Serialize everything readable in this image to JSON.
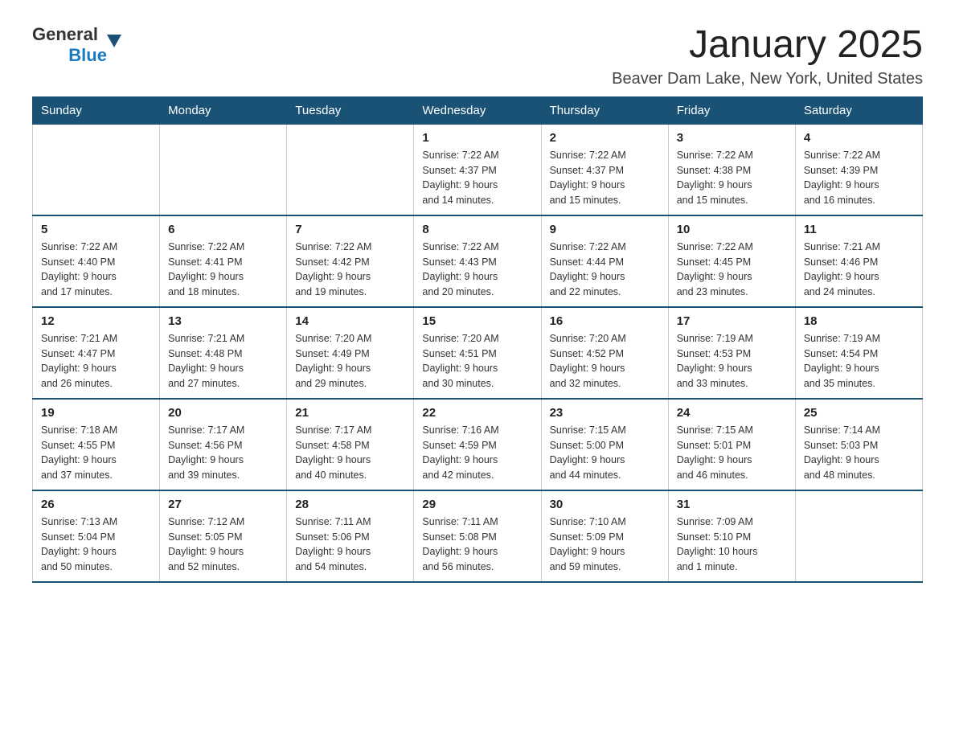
{
  "logo": {
    "general": "General",
    "blue": "Blue"
  },
  "title": "January 2025",
  "location": "Beaver Dam Lake, New York, United States",
  "days_of_week": [
    "Sunday",
    "Monday",
    "Tuesday",
    "Wednesday",
    "Thursday",
    "Friday",
    "Saturday"
  ],
  "weeks": [
    [
      {
        "day": "",
        "info": ""
      },
      {
        "day": "",
        "info": ""
      },
      {
        "day": "",
        "info": ""
      },
      {
        "day": "1",
        "info": "Sunrise: 7:22 AM\nSunset: 4:37 PM\nDaylight: 9 hours\nand 14 minutes."
      },
      {
        "day": "2",
        "info": "Sunrise: 7:22 AM\nSunset: 4:37 PM\nDaylight: 9 hours\nand 15 minutes."
      },
      {
        "day": "3",
        "info": "Sunrise: 7:22 AM\nSunset: 4:38 PM\nDaylight: 9 hours\nand 15 minutes."
      },
      {
        "day": "4",
        "info": "Sunrise: 7:22 AM\nSunset: 4:39 PM\nDaylight: 9 hours\nand 16 minutes."
      }
    ],
    [
      {
        "day": "5",
        "info": "Sunrise: 7:22 AM\nSunset: 4:40 PM\nDaylight: 9 hours\nand 17 minutes."
      },
      {
        "day": "6",
        "info": "Sunrise: 7:22 AM\nSunset: 4:41 PM\nDaylight: 9 hours\nand 18 minutes."
      },
      {
        "day": "7",
        "info": "Sunrise: 7:22 AM\nSunset: 4:42 PM\nDaylight: 9 hours\nand 19 minutes."
      },
      {
        "day": "8",
        "info": "Sunrise: 7:22 AM\nSunset: 4:43 PM\nDaylight: 9 hours\nand 20 minutes."
      },
      {
        "day": "9",
        "info": "Sunrise: 7:22 AM\nSunset: 4:44 PM\nDaylight: 9 hours\nand 22 minutes."
      },
      {
        "day": "10",
        "info": "Sunrise: 7:22 AM\nSunset: 4:45 PM\nDaylight: 9 hours\nand 23 minutes."
      },
      {
        "day": "11",
        "info": "Sunrise: 7:21 AM\nSunset: 4:46 PM\nDaylight: 9 hours\nand 24 minutes."
      }
    ],
    [
      {
        "day": "12",
        "info": "Sunrise: 7:21 AM\nSunset: 4:47 PM\nDaylight: 9 hours\nand 26 minutes."
      },
      {
        "day": "13",
        "info": "Sunrise: 7:21 AM\nSunset: 4:48 PM\nDaylight: 9 hours\nand 27 minutes."
      },
      {
        "day": "14",
        "info": "Sunrise: 7:20 AM\nSunset: 4:49 PM\nDaylight: 9 hours\nand 29 minutes."
      },
      {
        "day": "15",
        "info": "Sunrise: 7:20 AM\nSunset: 4:51 PM\nDaylight: 9 hours\nand 30 minutes."
      },
      {
        "day": "16",
        "info": "Sunrise: 7:20 AM\nSunset: 4:52 PM\nDaylight: 9 hours\nand 32 minutes."
      },
      {
        "day": "17",
        "info": "Sunrise: 7:19 AM\nSunset: 4:53 PM\nDaylight: 9 hours\nand 33 minutes."
      },
      {
        "day": "18",
        "info": "Sunrise: 7:19 AM\nSunset: 4:54 PM\nDaylight: 9 hours\nand 35 minutes."
      }
    ],
    [
      {
        "day": "19",
        "info": "Sunrise: 7:18 AM\nSunset: 4:55 PM\nDaylight: 9 hours\nand 37 minutes."
      },
      {
        "day": "20",
        "info": "Sunrise: 7:17 AM\nSunset: 4:56 PM\nDaylight: 9 hours\nand 39 minutes."
      },
      {
        "day": "21",
        "info": "Sunrise: 7:17 AM\nSunset: 4:58 PM\nDaylight: 9 hours\nand 40 minutes."
      },
      {
        "day": "22",
        "info": "Sunrise: 7:16 AM\nSunset: 4:59 PM\nDaylight: 9 hours\nand 42 minutes."
      },
      {
        "day": "23",
        "info": "Sunrise: 7:15 AM\nSunset: 5:00 PM\nDaylight: 9 hours\nand 44 minutes."
      },
      {
        "day": "24",
        "info": "Sunrise: 7:15 AM\nSunset: 5:01 PM\nDaylight: 9 hours\nand 46 minutes."
      },
      {
        "day": "25",
        "info": "Sunrise: 7:14 AM\nSunset: 5:03 PM\nDaylight: 9 hours\nand 48 minutes."
      }
    ],
    [
      {
        "day": "26",
        "info": "Sunrise: 7:13 AM\nSunset: 5:04 PM\nDaylight: 9 hours\nand 50 minutes."
      },
      {
        "day": "27",
        "info": "Sunrise: 7:12 AM\nSunset: 5:05 PM\nDaylight: 9 hours\nand 52 minutes."
      },
      {
        "day": "28",
        "info": "Sunrise: 7:11 AM\nSunset: 5:06 PM\nDaylight: 9 hours\nand 54 minutes."
      },
      {
        "day": "29",
        "info": "Sunrise: 7:11 AM\nSunset: 5:08 PM\nDaylight: 9 hours\nand 56 minutes."
      },
      {
        "day": "30",
        "info": "Sunrise: 7:10 AM\nSunset: 5:09 PM\nDaylight: 9 hours\nand 59 minutes."
      },
      {
        "day": "31",
        "info": "Sunrise: 7:09 AM\nSunset: 5:10 PM\nDaylight: 10 hours\nand 1 minute."
      },
      {
        "day": "",
        "info": ""
      }
    ]
  ]
}
